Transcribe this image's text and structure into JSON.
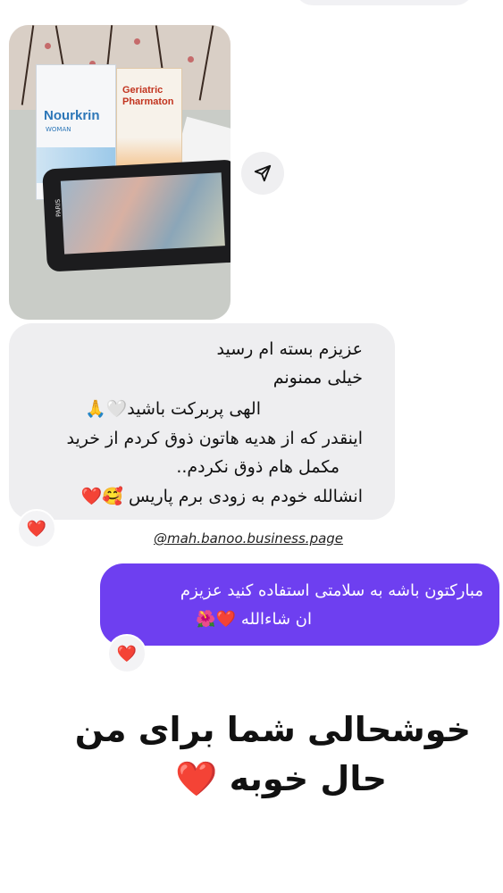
{
  "photo": {
    "box1_brand": "Nourkrin",
    "box1_sub": "WOMAN",
    "box2_brand": "Geriatric Pharmaton",
    "tray_text": "PARIS"
  },
  "incoming_message": {
    "lines": [
      "عزیزم بسته ام رسید",
      "خیلی ممنونم",
      "الهی پربرکت باشید🤍🙏",
      "اینقدر که از هدیه هاتون ذوق کردم از خرید",
      "مکمل هام ذوق نکردم..",
      "انشالله خودم به زودی برم پاریس 🥰❤️"
    ],
    "reaction": "❤️"
  },
  "handle": "@mah.banoo.business.page",
  "outgoing_message": {
    "lines": [
      "مبارکتون باشه به سلامتی استفاده کنید عزیزم",
      "ان شاءالله ❤️🌺"
    ],
    "reaction": "❤️"
  },
  "caption": {
    "line1": "خوشحالی شما برای من",
    "line2": "حال خوبه ❤️"
  },
  "colors": {
    "outgoing_bubble": "#6e3ff0",
    "incoming_bubble": "#eeeef0",
    "heart": "#e2192c"
  },
  "icons": {
    "share": "send-icon"
  }
}
